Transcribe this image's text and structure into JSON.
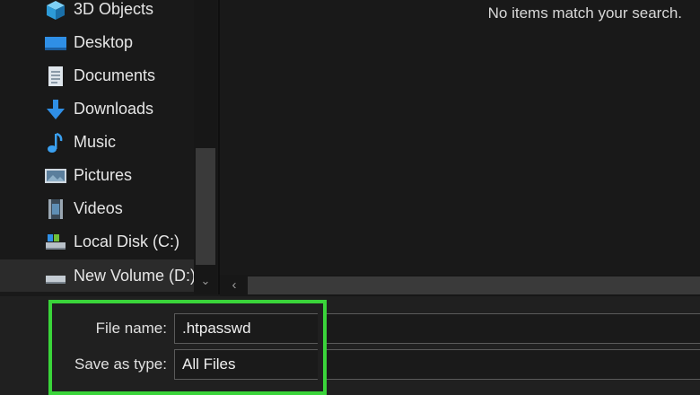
{
  "nav": {
    "items": [
      {
        "label": "3D Objects",
        "icon": "3d-objects-icon"
      },
      {
        "label": "Desktop",
        "icon": "desktop-icon"
      },
      {
        "label": "Documents",
        "icon": "documents-icon"
      },
      {
        "label": "Downloads",
        "icon": "downloads-icon"
      },
      {
        "label": "Music",
        "icon": "music-icon"
      },
      {
        "label": "Pictures",
        "icon": "pictures-icon"
      },
      {
        "label": "Videos",
        "icon": "videos-icon"
      },
      {
        "label": "Local Disk (C:)",
        "icon": "local-disk-icon"
      },
      {
        "label": "New Volume (D:)",
        "icon": "drive-icon"
      }
    ]
  },
  "content": {
    "empty_message": "No items match your search."
  },
  "save": {
    "file_name_label": "File name:",
    "file_name_value": ".htpasswd",
    "save_type_label": "Save as type:",
    "save_type_value": "All Files"
  },
  "colors": {
    "background": "#191919",
    "highlight": "#3ad43a",
    "accent_blue": "#2f8fe6"
  }
}
